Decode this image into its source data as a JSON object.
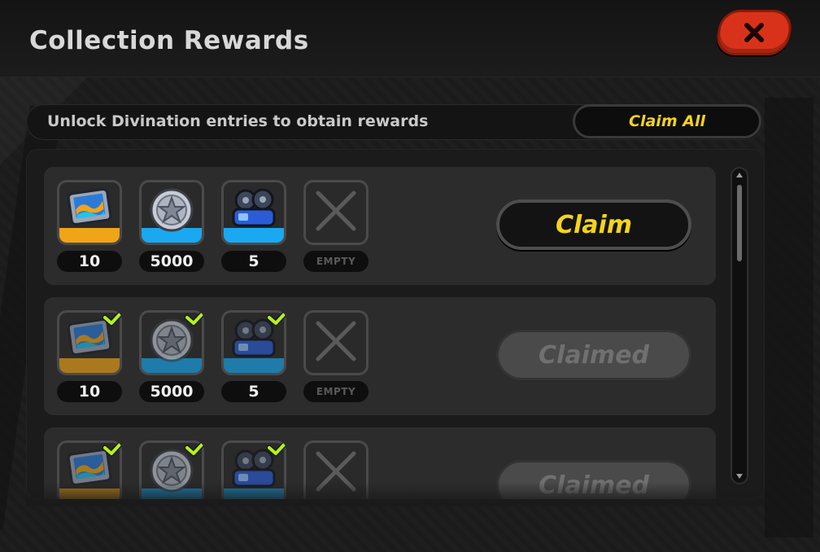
{
  "header": {
    "title": "Collection Rewards"
  },
  "banner": {
    "text": "Unlock Divination entries to obtain rewards",
    "claim_all": "Claim All"
  },
  "rows": [
    {
      "button": "Claim",
      "rewards": [
        {
          "icon": "film-reel-card-icon",
          "qty": "10",
          "rarity": "orange",
          "claimed": false
        },
        {
          "icon": "silver-star-coin-icon",
          "qty": "5000",
          "rarity": "blue",
          "claimed": false
        },
        {
          "icon": "blue-projector-icon",
          "qty": "5",
          "rarity": "blue",
          "claimed": false
        },
        {
          "icon": "empty-slot-icon",
          "qty": "EMPTY",
          "rarity": "none",
          "claimed": false
        }
      ]
    },
    {
      "button": "Claimed",
      "rewards": [
        {
          "icon": "film-reel-card-icon",
          "qty": "10",
          "rarity": "orange",
          "claimed": true
        },
        {
          "icon": "silver-star-coin-icon",
          "qty": "5000",
          "rarity": "blue",
          "claimed": true
        },
        {
          "icon": "blue-projector-icon",
          "qty": "5",
          "rarity": "blue",
          "claimed": true
        },
        {
          "icon": "empty-slot-icon",
          "qty": "EMPTY",
          "rarity": "none",
          "claimed": false
        }
      ]
    },
    {
      "button": "Claimed",
      "rewards": [
        {
          "icon": "film-reel-card-icon",
          "rarity": "orange",
          "claimed": true
        },
        {
          "icon": "silver-star-coin-icon",
          "rarity": "blue",
          "claimed": true
        },
        {
          "icon": "blue-projector-icon",
          "rarity": "blue",
          "claimed": true
        },
        {
          "icon": "empty-slot-icon",
          "rarity": "none",
          "claimed": false
        }
      ]
    }
  ],
  "colors": {
    "accent_yellow": "#f5d418",
    "close_red": "#d8331a",
    "rarity_orange": "#f0a418",
    "rarity_blue": "#1aa8f0",
    "check_green": "#b7f01c"
  }
}
